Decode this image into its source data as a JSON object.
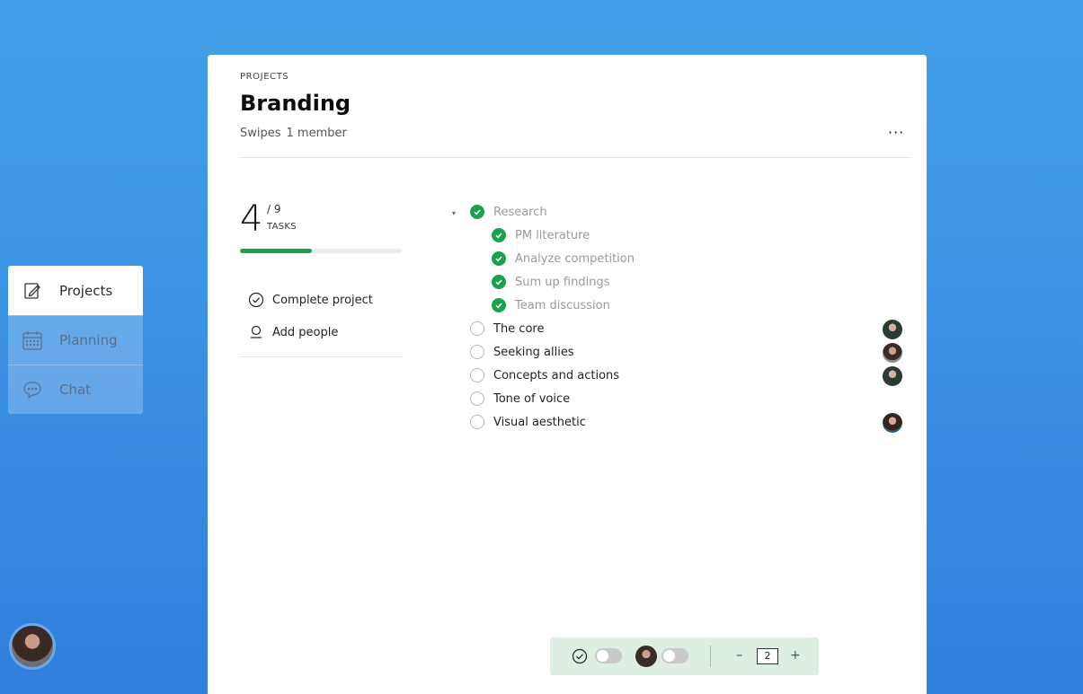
{
  "nav": {
    "items": [
      {
        "label": "Projects",
        "icon": "edit-note-icon",
        "active": true
      },
      {
        "label": "Planning",
        "icon": "calendar-icon",
        "active": false
      },
      {
        "label": "Chat",
        "icon": "chat-bubble-icon",
        "active": false
      }
    ]
  },
  "project": {
    "eyebrow": "PROJECTS",
    "title": "Branding",
    "workspace": "Swipes",
    "members": "1 member",
    "more_label": "···"
  },
  "progress": {
    "done": "4",
    "total": "/ 9",
    "label": "TASKS",
    "fraction": 0.444
  },
  "actions": {
    "complete": "Complete project",
    "add_people": "Add people"
  },
  "tasks": {
    "parent": {
      "label": "Research",
      "done": true,
      "caret": "▾"
    },
    "subtasks": [
      {
        "label": "PM literature",
        "done": true
      },
      {
        "label": "Analyze competition",
        "done": true
      },
      {
        "label": "Sum up findings",
        "done": true
      },
      {
        "label": "Team discussion",
        "done": true
      }
    ],
    "items": [
      {
        "label": "The core",
        "done": false,
        "assigned": true
      },
      {
        "label": "Seeking allies",
        "done": false,
        "assigned": true
      },
      {
        "label": "Concepts and actions",
        "done": false,
        "assigned": true
      },
      {
        "label": "Tone of voice",
        "done": false,
        "assigned": false
      },
      {
        "label": "Visual aesthetic",
        "done": false,
        "assigned": true
      }
    ]
  },
  "toolbar": {
    "stepper_minus": "–",
    "stepper_value": "2",
    "stepper_plus": "+"
  },
  "colors": {
    "accent_green": "#16a34a",
    "background_blue": "#3b8fe2"
  }
}
